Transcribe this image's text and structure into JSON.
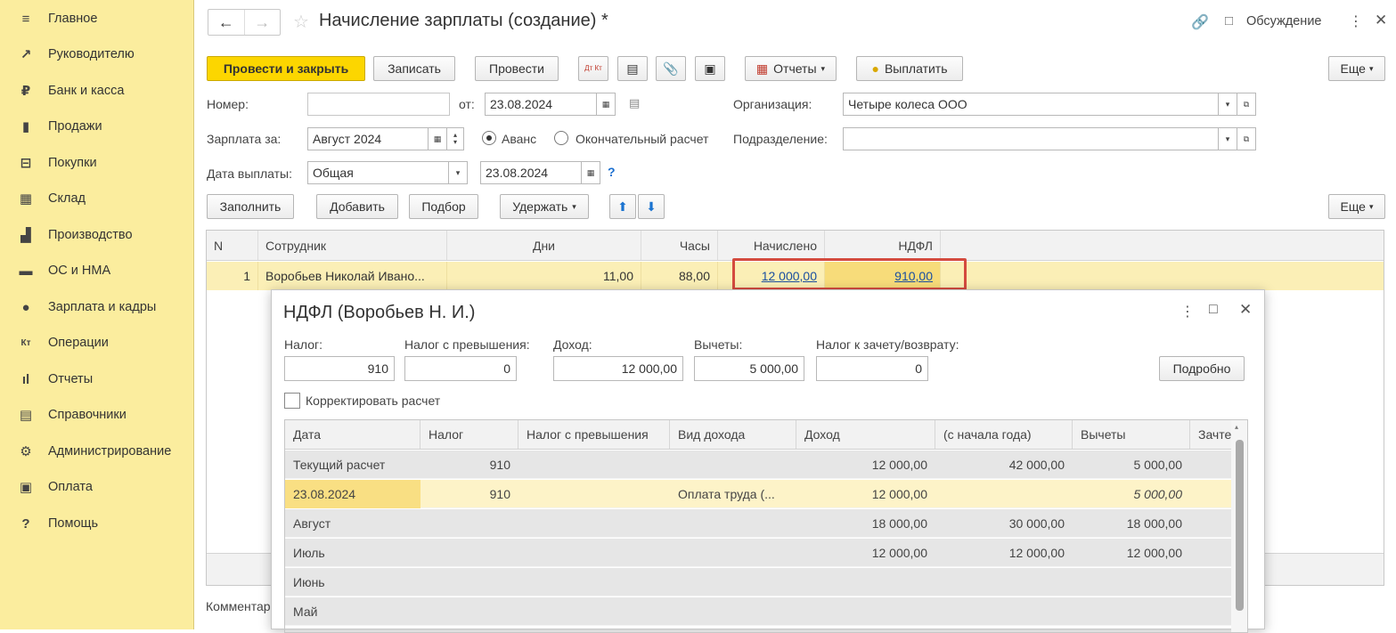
{
  "sidebar": {
    "items": [
      {
        "label": "Главное",
        "icon": "≡"
      },
      {
        "label": "Руководителю",
        "icon": "↗"
      },
      {
        "label": "Банк и касса",
        "icon": "₽"
      },
      {
        "label": "Продажи",
        "icon": "▮"
      },
      {
        "label": "Покупки",
        "icon": "⊟"
      },
      {
        "label": "Склад",
        "icon": "▦"
      },
      {
        "label": "Производство",
        "icon": "▟"
      },
      {
        "label": "ОС и НМА",
        "icon": "▬"
      },
      {
        "label": "Зарплата и кадры",
        "icon": "●"
      },
      {
        "label": "Операции",
        "icon": "Кт"
      },
      {
        "label": "Отчеты",
        "icon": "ıl"
      },
      {
        "label": "Справочники",
        "icon": "▤"
      },
      {
        "label": "Администрирование",
        "icon": "⚙"
      },
      {
        "label": "Оплата",
        "icon": "▣"
      },
      {
        "label": "Помощь",
        "icon": "?"
      }
    ]
  },
  "header": {
    "title": "Начисление зарплаты (создание) *",
    "discussion": "Обсуждение"
  },
  "toolbar": {
    "post_close": "Провести и закрыть",
    "save": "Записать",
    "post": "Провести",
    "dt_kt": "Дт Кт",
    "reports": "Отчеты",
    "pay": "Выплатить",
    "more": "Еще"
  },
  "form": {
    "number_label": "Номер:",
    "number_value": "",
    "from_label": "от:",
    "date_value": "23.08.2024",
    "org_label": "Организация:",
    "org_value": "Четыре колеса ООО",
    "salary_for_label": "Зарплата за:",
    "salary_for_value": "Август 2024",
    "advance_label": "Аванс",
    "final_label": "Окончательный расчет",
    "dept_label": "Подразделение:",
    "dept_value": "",
    "pay_date_label": "Дата выплаты:",
    "pay_type_value": "Общая",
    "pay_date_value": "23.08.2024",
    "help": "?"
  },
  "table_toolbar": {
    "fill": "Заполнить",
    "add": "Добавить",
    "select": "Подбор",
    "withhold": "Удержать",
    "more": "Еще"
  },
  "table": {
    "headers": [
      "N",
      "Сотрудник",
      "Дни",
      "Часы",
      "Начислено",
      "НДФЛ"
    ],
    "rows": [
      {
        "n": "1",
        "employee": "Воробьев Николай Ивано...",
        "days": "11,00",
        "hours": "88,00",
        "accrued": "12 000,00",
        "ndfl": "910,00"
      }
    ]
  },
  "comment_label": "Комментар",
  "dialog": {
    "title": "НДФЛ (Воробьев Н. И.)",
    "tax_label": "Налог:",
    "tax_value": "910",
    "excess_label": "Налог с превышения:",
    "excess_value": "0",
    "income_label": "Доход:",
    "income_value": "12 000,00",
    "deductions_label": "Вычеты:",
    "deductions_value": "5 000,00",
    "offset_label": "Налог к зачету/возврату:",
    "offset_value": "0",
    "details": "Подробно",
    "correct_label": "Корректировать расчет",
    "headers": [
      "Дата",
      "Налог",
      "Налог с превышения",
      "Вид дохода",
      "Доход",
      "(с начала года)",
      "Вычеты",
      "Зачте"
    ],
    "rows": [
      {
        "date": "Текущий расчет",
        "tax": "910",
        "excess": "",
        "kind": "",
        "income": "12 000,00",
        "ytd": "42 000,00",
        "ded": "5 000,00"
      },
      {
        "date": "23.08.2024",
        "tax": "910",
        "excess": "",
        "kind": "Оплата труда (...",
        "income": "12 000,00",
        "ytd": "",
        "ded": "5 000,00"
      },
      {
        "date": "Август",
        "tax": "",
        "excess": "",
        "kind": "",
        "income": "18 000,00",
        "ytd": "30 000,00",
        "ded": "18 000,00"
      },
      {
        "date": "Июль",
        "tax": "",
        "excess": "",
        "kind": "",
        "income": "12 000,00",
        "ytd": "12 000,00",
        "ded": "12 000,00"
      },
      {
        "date": "Июнь",
        "tax": "",
        "excess": "",
        "kind": "",
        "income": "",
        "ytd": "",
        "ded": ""
      },
      {
        "date": "Май",
        "tax": "",
        "excess": "",
        "kind": "",
        "income": "",
        "ytd": "",
        "ded": ""
      }
    ]
  },
  "colors": {
    "sidebar_bg": "#fbed9e",
    "primary": "#fcd600",
    "highlight": "#d44b3f",
    "link": "#1a4fa0"
  }
}
